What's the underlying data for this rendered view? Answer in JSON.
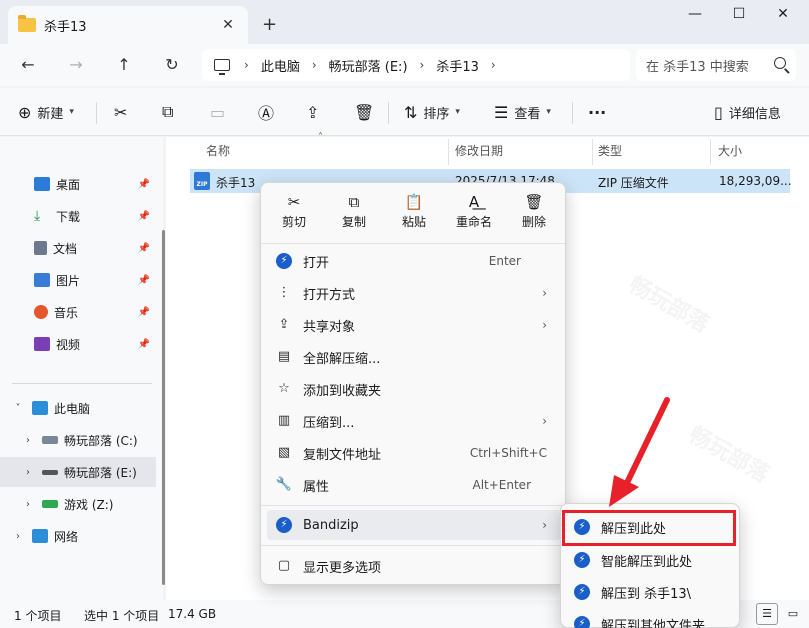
{
  "window": {
    "tab_title": "杀手13",
    "tab_close": "✕",
    "new_tab": "+",
    "minimize": "—",
    "maximize": "☐",
    "close": "✕"
  },
  "nav": {
    "back": "←",
    "forward": "→",
    "up": "↑",
    "refresh": "↻",
    "breadcrumbs": [
      "此电脑",
      "畅玩部落 (E:)",
      "杀手13"
    ],
    "separator": "›",
    "search_placeholder": "在 杀手13 中搜索"
  },
  "toolbar": {
    "new_label": "新建",
    "sort_label": "排序",
    "view_label": "查看",
    "more": "···",
    "details_label": "详细信息"
  },
  "sidebar": {
    "quick": [
      {
        "label": "桌面",
        "color": "#2c7bd6"
      },
      {
        "label": "下载",
        "color": "#2e8b57"
      },
      {
        "label": "文档",
        "color": "#6b7a8f"
      },
      {
        "label": "图片",
        "color": "#3a7bd5"
      },
      {
        "label": "音乐",
        "color": "#e4572e"
      },
      {
        "label": "视频",
        "color": "#7b3fb5"
      }
    ],
    "this_pc": "此电脑",
    "drives": [
      {
        "label": "畅玩部落 (C:)"
      },
      {
        "label": "畅玩部落 (E:)"
      },
      {
        "label": "游戏 (Z:)"
      }
    ],
    "network": "网络"
  },
  "columns": {
    "name": "名称",
    "modified": "修改日期",
    "type": "类型",
    "size": "大小"
  },
  "file": {
    "name": "杀手13",
    "modified": "2025/7/13 17:48",
    "type": "ZIP 压缩文件",
    "size": "18,293,09..."
  },
  "context_menu": {
    "quick_actions": [
      {
        "label": "剪切",
        "icon": "✂"
      },
      {
        "label": "复制",
        "icon": "⧉"
      },
      {
        "label": "粘贴",
        "icon": "📋"
      },
      {
        "label": "重命名",
        "icon": "A͟"
      },
      {
        "label": "删除",
        "icon": "🗑"
      }
    ],
    "items": [
      {
        "label": "打开",
        "shortcut": "Enter",
        "submenu": ""
      },
      {
        "label": "打开方式",
        "shortcut": "",
        "submenu": "›"
      },
      {
        "label": "共享对象",
        "shortcut": "",
        "submenu": "›"
      },
      {
        "label": "全部解压缩...",
        "shortcut": "",
        "submenu": ""
      },
      {
        "label": "添加到收藏夹",
        "shortcut": "",
        "submenu": ""
      },
      {
        "label": "压缩到...",
        "shortcut": "",
        "submenu": "›"
      },
      {
        "label": "复制文件地址",
        "shortcut": "Ctrl+Shift+C",
        "submenu": ""
      },
      {
        "label": "属性",
        "shortcut": "Alt+Enter",
        "submenu": ""
      }
    ],
    "bandizip": "Bandizip",
    "bandizip_arrow": "›",
    "more_options": "显示更多选项"
  },
  "submenu": {
    "items": [
      "解压到此处",
      "智能解压到此处",
      "解压到 杀手13\\",
      "解压到其他文件夹..."
    ]
  },
  "status": {
    "count": "1 个项目",
    "selected": "选中 1 个项目",
    "size": "17.4 GB"
  },
  "colors": {
    "selection": "#cce4f7",
    "highlight_border": "#e8202a",
    "bandizip_blue": "#1a5fc9"
  }
}
